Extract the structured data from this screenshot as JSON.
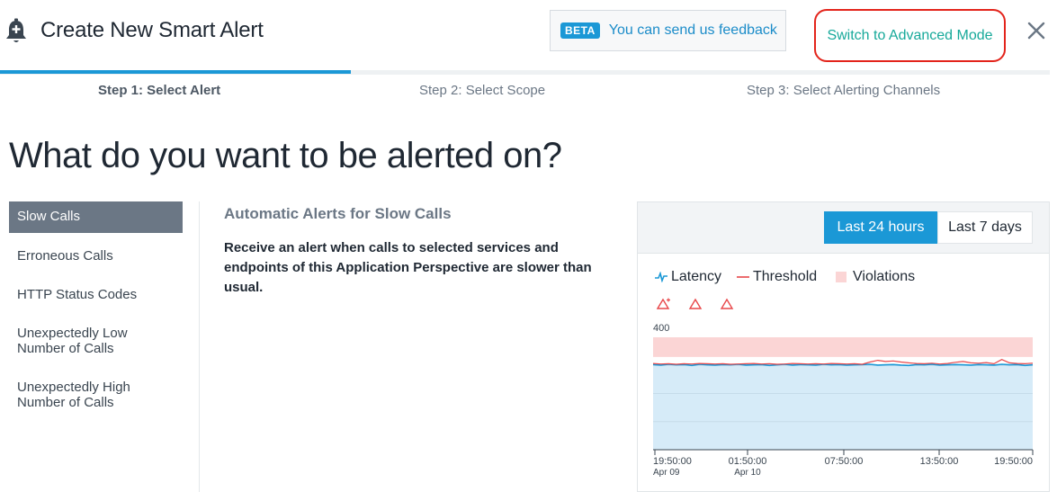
{
  "header": {
    "title": "Create New Smart Alert",
    "beta_badge": "BETA",
    "feedback_text": "You can send us feedback",
    "advanced_mode_label": "Switch to Advanced Mode"
  },
  "steps": [
    "Step 1: Select Alert",
    "Step 2: Select Scope",
    "Step 3: Select Alerting Channels"
  ],
  "active_step_index": 0,
  "question": "What do you want to be alerted on?",
  "sidebar": {
    "items": [
      {
        "label": "Slow Calls",
        "active": true
      },
      {
        "label": "Erroneous Calls",
        "active": false
      },
      {
        "label": "HTTP Status Codes",
        "active": false
      },
      {
        "label": "Unexpectedly Low Number of Calls",
        "active": false
      },
      {
        "label": "Unexpectedly High Number of Calls",
        "active": false
      }
    ]
  },
  "detail": {
    "title": "Automatic Alerts for Slow Calls",
    "description": "Receive an alert when calls to selected services and endpoints of this Application Perspective are slower than usual."
  },
  "time_range": {
    "options": [
      "Last 24 hours",
      "Last 7 days"
    ],
    "selected": "Last 24 hours"
  },
  "legend": {
    "latency": "Latency",
    "threshold": "Threshold",
    "violations": "Violations"
  },
  "colors": {
    "accent": "#1b98d6",
    "advanced_link": "#17a99a",
    "highlight_border": "#e3241b",
    "latency": "#1b98d6",
    "threshold": "#e8474a",
    "violations_fill": "#fbd5d5",
    "latency_fill": "#d6ebf8"
  },
  "chart_data": {
    "type": "line",
    "ylim": [
      0,
      400
    ],
    "y_tick_labels": [
      "400"
    ],
    "x_tick_labels": [
      {
        "time": "19:50:00",
        "date": "Apr 09"
      },
      {
        "time": "01:50:00",
        "date": "Apr 10"
      },
      {
        "time": "07:50:00",
        "date": ""
      },
      {
        "time": "13:50:00",
        "date": ""
      },
      {
        "time": "19:50:00",
        "date": ""
      }
    ],
    "series": [
      {
        "name": "Latency",
        "values": [
          303,
          301,
          304,
          302,
          303,
          300,
          304,
          302,
          301,
          303,
          302,
          304,
          301,
          302,
          303,
          300,
          302,
          304,
          301,
          303,
          302,
          301,
          304,
          302,
          303,
          301,
          302,
          303,
          304,
          301,
          302,
          303,
          301,
          300,
          303,
          302,
          304,
          301,
          302,
          303,
          302,
          301,
          303,
          302,
          301,
          304,
          302,
          303,
          300,
          302
        ]
      },
      {
        "name": "Threshold",
        "values": [
          307,
          305,
          306,
          304,
          306,
          305,
          307,
          306,
          305,
          306,
          304,
          305,
          306,
          307,
          305,
          306,
          304,
          305,
          307,
          306,
          305,
          306,
          305,
          307,
          306,
          305,
          306,
          304,
          312,
          318,
          314,
          316,
          312,
          309,
          307,
          306,
          308,
          305,
          307,
          311,
          314,
          309,
          308,
          310,
          306,
          321,
          309,
          307,
          306,
          308
        ]
      }
    ],
    "violations_band": [
      330,
      400
    ]
  }
}
